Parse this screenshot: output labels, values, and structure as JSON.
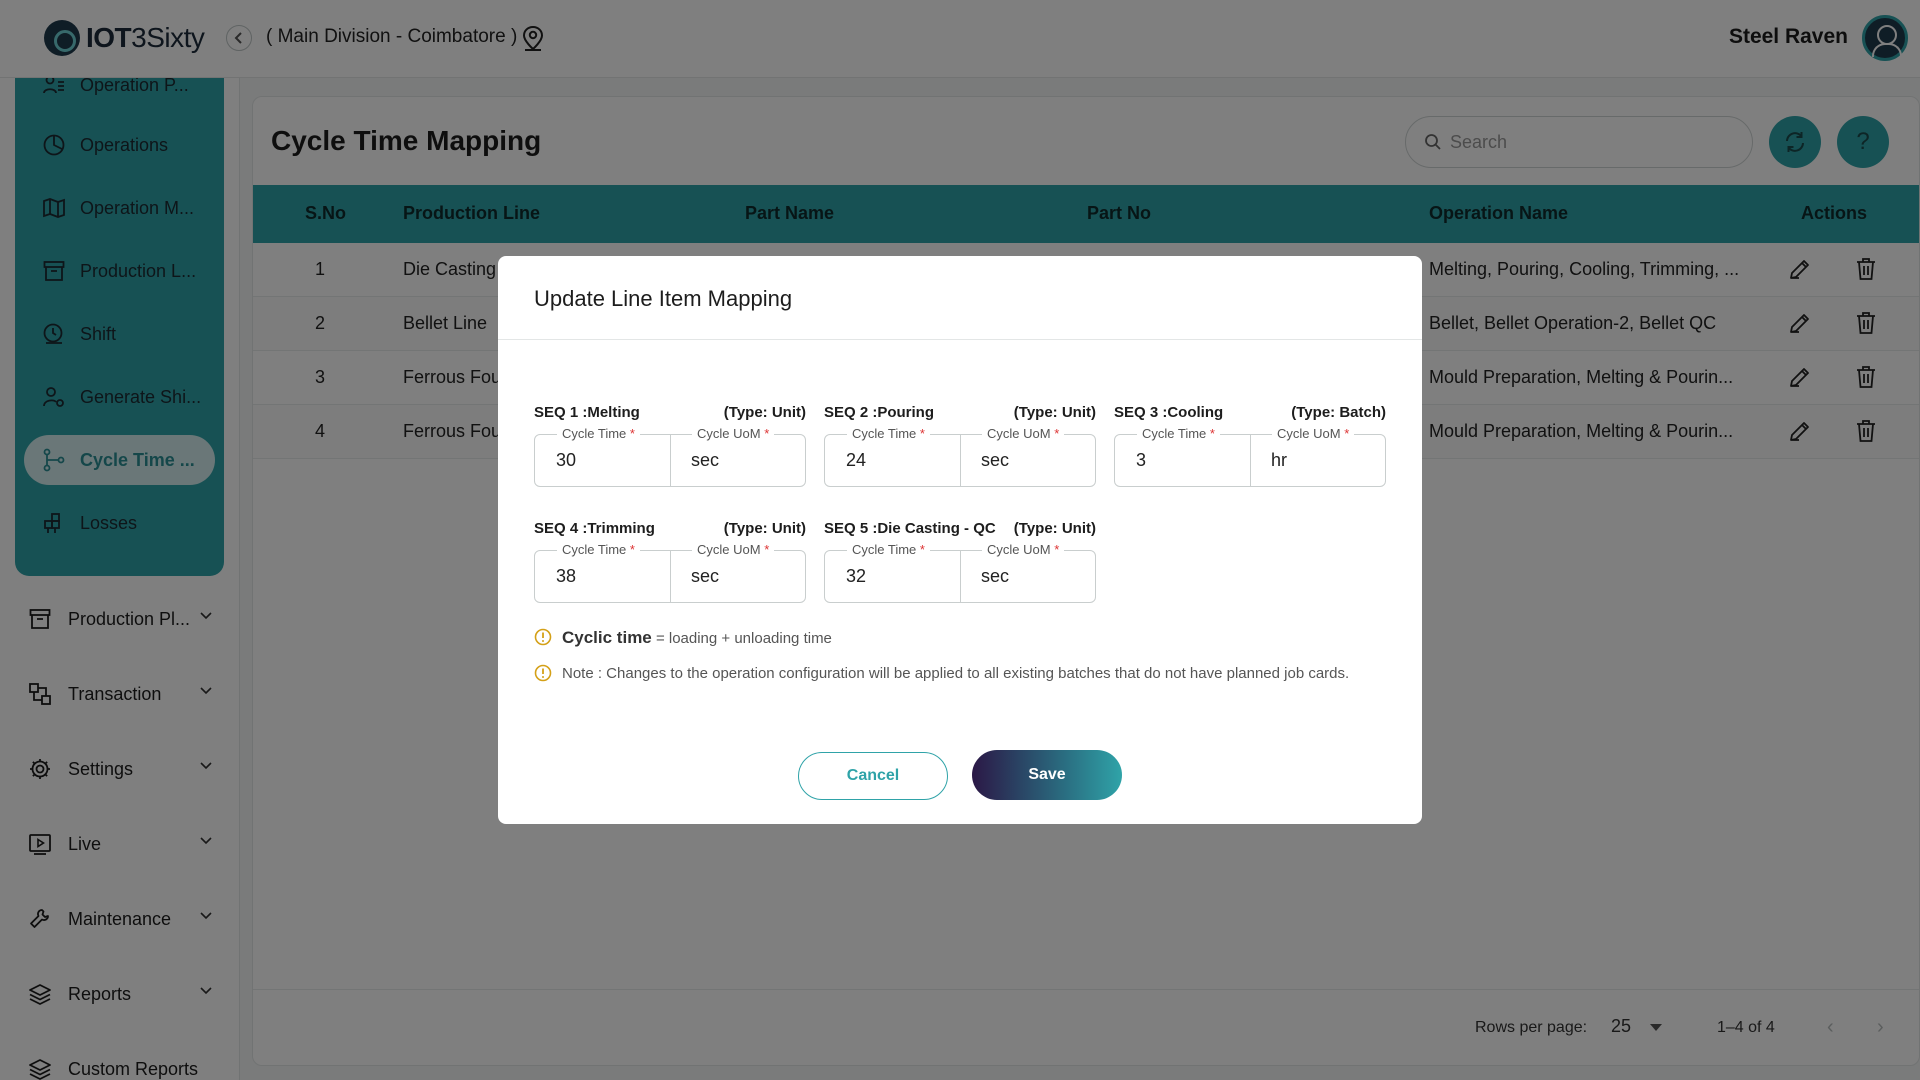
{
  "app": {
    "logo_bold": "IOT",
    "logo_rest": "3Sixty",
    "division": "( Main Division - Coimbatore )",
    "user_name": "Steel Raven"
  },
  "sidebar": {
    "sub_items": [
      {
        "label": "Operation P...",
        "icon": "user-list-icon"
      },
      {
        "label": "Operations",
        "icon": "pie-icon"
      },
      {
        "label": "Operation M...",
        "icon": "map-icon"
      },
      {
        "label": "Production L...",
        "icon": "archive-icon"
      },
      {
        "label": "Shift",
        "icon": "clock-icon"
      },
      {
        "label": "Generate Shi...",
        "icon": "user-settings-icon"
      },
      {
        "label": "Cycle Time ...",
        "icon": "flow-icon",
        "active": true
      },
      {
        "label": "Losses",
        "icon": "blocks-icon"
      }
    ],
    "main_items": [
      {
        "label": "Production Pl...",
        "icon": "archive-icon"
      },
      {
        "label": "Transaction",
        "icon": "transaction-icon"
      },
      {
        "label": "Settings",
        "icon": "gear-icon"
      },
      {
        "label": "Live",
        "icon": "play-icon"
      },
      {
        "label": "Maintenance",
        "icon": "wrench-icon"
      },
      {
        "label": "Reports",
        "icon": "layers-icon"
      },
      {
        "label": "Custom Reports",
        "icon": "layers-icon"
      }
    ]
  },
  "page": {
    "title": "Cycle Time Mapping",
    "search_placeholder": "Search"
  },
  "table": {
    "columns": [
      "S.No",
      "Production Line",
      "Part Name",
      "Part No",
      "Operation Name",
      "Actions"
    ],
    "rows": [
      {
        "sno": "1",
        "line": "Die Casting",
        "operations": "Melting, Pouring, Cooling, Trimming, ..."
      },
      {
        "sno": "2",
        "line": "Bellet Line",
        "operations": "Bellet, Bellet Operation-2, Bellet QC"
      },
      {
        "sno": "3",
        "line": "Ferrous Fou",
        "operations": "Mould Preparation, Melting & Pourin..."
      },
      {
        "sno": "4",
        "line": "Ferrous Fou",
        "operations": "Mould Preparation, Melting & Pourin..."
      }
    ]
  },
  "pagination": {
    "rows_per_page_label": "Rows per page:",
    "rows_per_page": "25",
    "range": "1–4 of 4"
  },
  "modal": {
    "title": "Update Line Item Mapping",
    "cycle_time_label": "Cycle Time",
    "cycle_uom_label": "Cycle UoM",
    "required_mark": "*",
    "sequences": [
      {
        "title": "SEQ 1 :Melting",
        "type": "(Type: Unit)",
        "cycle_time": "30",
        "uom": "sec"
      },
      {
        "title": "SEQ 2 :Pouring",
        "type": "(Type: Unit)",
        "cycle_time": "24",
        "uom": "sec"
      },
      {
        "title": "SEQ 3 :Cooling",
        "type": "(Type: Batch)",
        "cycle_time": "3",
        "uom": "hr"
      },
      {
        "title": "SEQ 4 :Trimming",
        "type": "(Type: Unit)",
        "cycle_time": "38",
        "uom": "sec"
      },
      {
        "title": "SEQ 5 :Die Casting - QC",
        "type": "(Type: Unit)",
        "cycle_time": "32",
        "uom": "sec"
      }
    ],
    "formula_term": "Cyclic time",
    "formula_rest": "= loading + unloading time",
    "note": "Note : Changes to the operation configuration will be applied to all existing batches that do not have planned job cards.",
    "cancel_label": "Cancel",
    "save_label": "Save"
  },
  "colors": {
    "accent": "#2fa3a8",
    "sidebar_panel": "#2fa3a8",
    "overlay": "rgba(0,0,0,0.5)",
    "required": "#d33",
    "warning": "#d4a017"
  }
}
